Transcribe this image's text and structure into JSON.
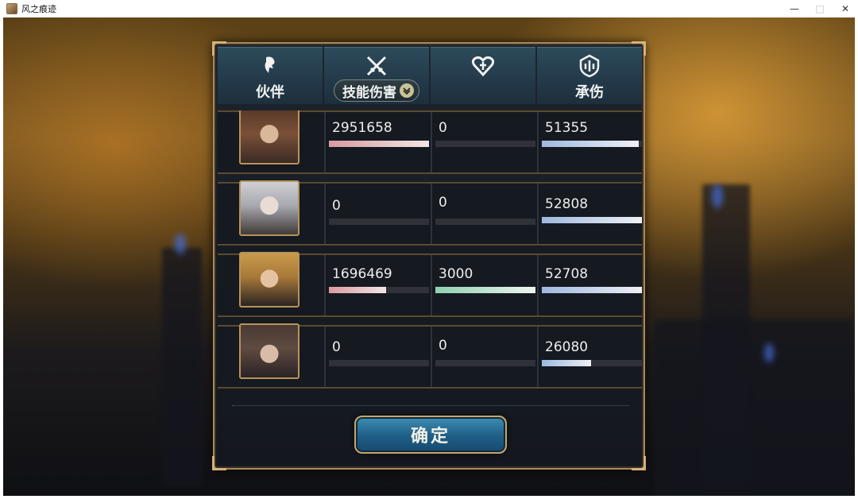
{
  "window": {
    "title": "风之痕迹",
    "minimize": "—",
    "maximize": "□",
    "close": "✕"
  },
  "tabs": [
    {
      "label": "伙伴",
      "icon": "partner-icon",
      "has_dropdown": false
    },
    {
      "label": "技能伤害",
      "icon": "crossed-swords-icon",
      "has_dropdown": true
    },
    {
      "label": "",
      "icon": "heart-heal-icon",
      "has_dropdown": false
    },
    {
      "label": "承伤",
      "icon": "shield-icon",
      "has_dropdown": false
    }
  ],
  "rows": [
    {
      "character": "brown-hair-girl",
      "damage": "2951658",
      "damage_fill": 1.0,
      "heal": "0",
      "heal_fill": 0.0,
      "taken": "51355",
      "taken_fill": 0.97
    },
    {
      "character": "silver-hair-girl",
      "damage": "0",
      "damage_fill": 0.0,
      "heal": "0",
      "heal_fill": 0.0,
      "taken": "52808",
      "taken_fill": 1.0
    },
    {
      "character": "blonde-hair-girl",
      "damage": "1696469",
      "damage_fill": 0.57,
      "heal": "3000",
      "heal_fill": 1.0,
      "taken": "52708",
      "taken_fill": 1.0
    },
    {
      "character": "dark-hair-girl",
      "damage": "0",
      "damage_fill": 0.0,
      "heal": "0",
      "heal_fill": 0.0,
      "taken": "26080",
      "taken_fill": 0.49
    }
  ],
  "confirm_label": "确定",
  "colors": {
    "damage_bar": "#d99aa0",
    "heal_bar": "#8fd0b0",
    "taken_bar": "#9fb8e0",
    "frame_gold": "#a88a5a"
  }
}
